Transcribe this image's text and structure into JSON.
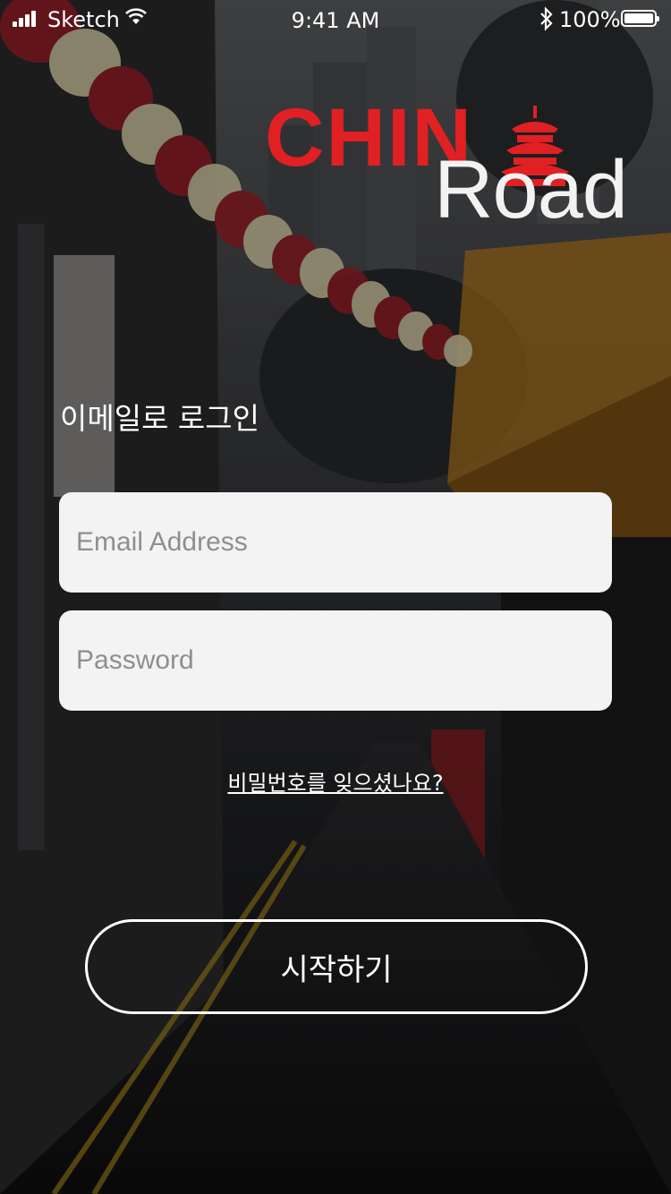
{
  "status_bar": {
    "carrier": "Sketch",
    "time": "9:41 AM",
    "battery": "100%"
  },
  "logo": {
    "word_red": "CHIN",
    "word_white": "Road"
  },
  "login": {
    "heading": "이메일로 로그인",
    "email_placeholder": "Email Address",
    "password_placeholder": "Password",
    "forgot_link": "비밀번호를 잊으셨나요?",
    "start_button": "시작하기"
  },
  "colors": {
    "brand_red": "#e02022",
    "field_background": "#f3f3f4",
    "placeholder": "#8e8e93"
  },
  "icons": {
    "signal": "signal-bars-icon",
    "wifi": "wifi-icon",
    "bluetooth": "bluetooth-icon",
    "battery": "battery-icon",
    "temple": "temple-of-heaven-icon"
  }
}
